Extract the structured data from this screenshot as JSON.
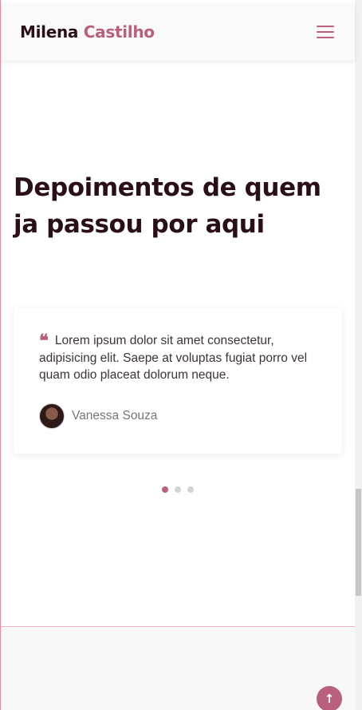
{
  "header": {
    "brand_first": "Milena",
    "brand_last": "Castilho",
    "menu_icon": "hamburger-menu-icon"
  },
  "main": {
    "heading": "Depoimentos de quem ja passou por aqui",
    "testimonials": [
      {
        "quote_icon": "quote-icon",
        "quote_mark": "❝",
        "text": "Lorem ipsum dolor sit amet consectetur, adipisicing elit. Saepe at voluptas fugiat porro vel quam odio placeat dolorum neque.",
        "author": "Vanessa Souza",
        "avatar_icon": "avatar-photo"
      }
    ],
    "carousel": {
      "slide_count": 3,
      "active_index": 0
    }
  },
  "back_to_top": {
    "icon": "arrow-up-icon",
    "glyph": "↑"
  },
  "colors": {
    "accent": "#b9607c",
    "heading": "#2a0f1a",
    "navbar_bg": "#f9f9f9",
    "footer_bg": "#f8f8f8"
  }
}
